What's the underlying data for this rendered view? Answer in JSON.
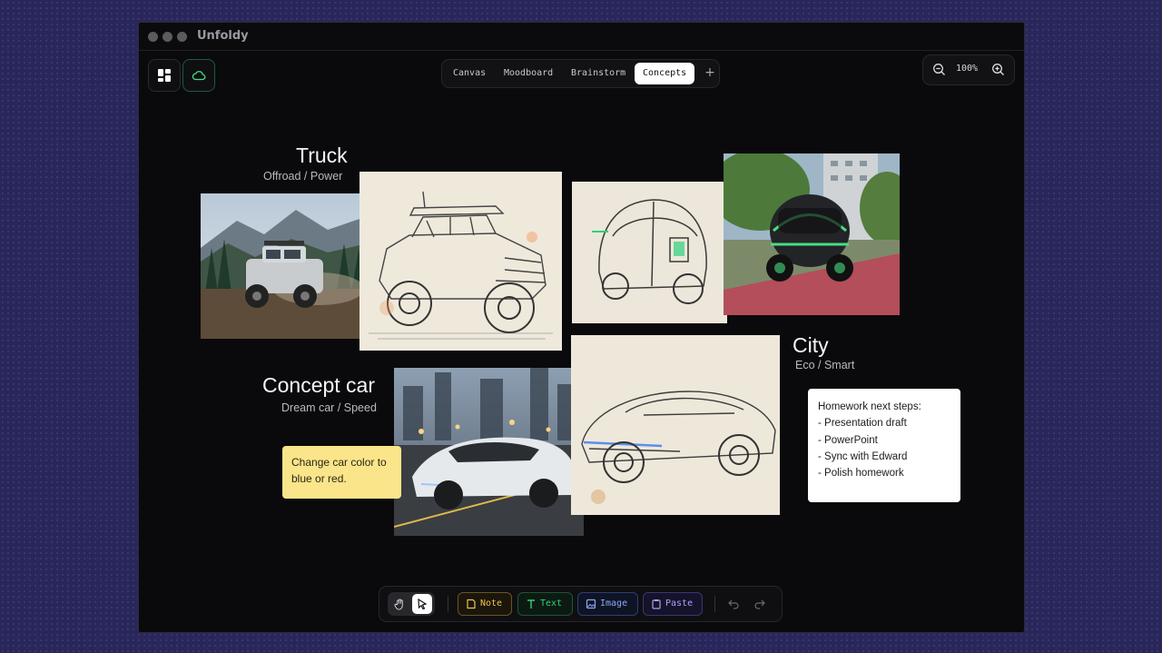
{
  "window": {
    "title": "Unfoldy"
  },
  "tabs": [
    {
      "label": "Canvas",
      "active": false
    },
    {
      "label": "Moodboard",
      "active": false
    },
    {
      "label": "Brainstorm",
      "active": false
    },
    {
      "label": "Concepts",
      "active": true
    }
  ],
  "zoom": {
    "level": "100%"
  },
  "groups": {
    "truck": {
      "title": "Truck",
      "subtitle": "Offroad / Power"
    },
    "city": {
      "title": "City",
      "subtitle": "Eco / Smart"
    },
    "concept": {
      "title": "Concept car",
      "subtitle": "Dream car / Speed"
    }
  },
  "notes": {
    "yellow": {
      "line1": "Change car color to",
      "line2": "blue or red."
    },
    "white": {
      "heading": "Homework next steps:",
      "items": [
        "- Presentation draft",
        "- PowerPoint",
        "- Sync with Edward",
        "- Polish homework"
      ]
    }
  },
  "toolbar": {
    "note_label": "Note",
    "text_label": "Text",
    "image_label": "Image",
    "paste_label": "Paste"
  },
  "colors": {
    "accent_green": "#4ade80",
    "note_yellow": "#fbe58a",
    "note_border": "#e0a72a",
    "text_green": "#2fd17a",
    "image_blue": "#6b8ef0",
    "paste_purple": "#8a86f0"
  }
}
